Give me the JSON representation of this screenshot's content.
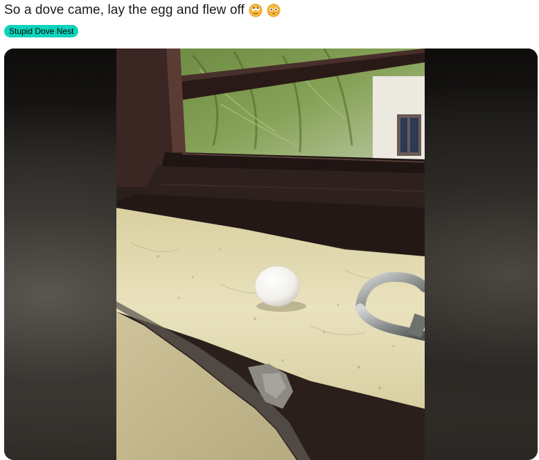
{
  "post": {
    "title": "So a dove came, lay the egg and flew off",
    "title_emojis": [
      "eyes-rolling-emoji",
      "flushed-face-emoji"
    ],
    "flair": "Stupid Dove Nest",
    "flair_color": "#0dd3bb"
  },
  "media": {
    "subject": "egg-on-window-sill-photo"
  }
}
